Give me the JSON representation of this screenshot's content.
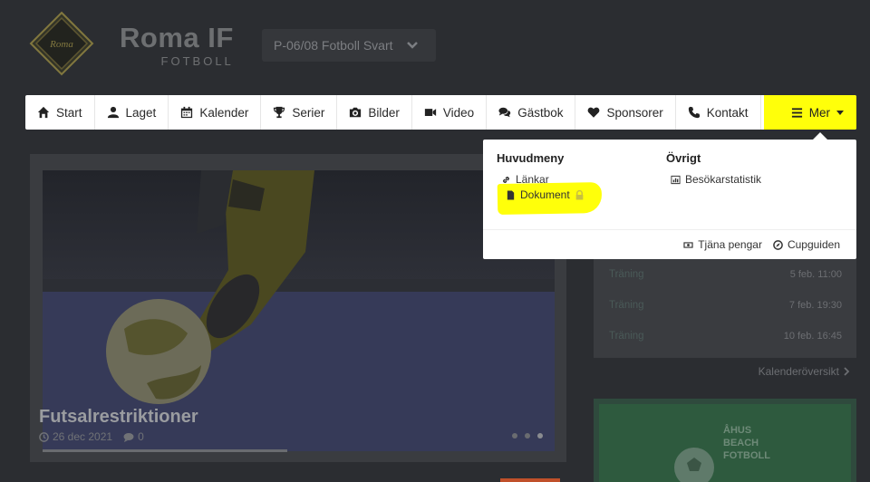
{
  "header": {
    "brand_name": "Roma IF",
    "brand_sub": "FOTBOLL",
    "logo_text": "Roma",
    "team_select": "P-06/08 Fotboll Svart"
  },
  "nav": {
    "items": [
      {
        "label": "Start",
        "icon": "home-icon"
      },
      {
        "label": "Laget",
        "icon": "user-icon"
      },
      {
        "label": "Kalender",
        "icon": "calendar-icon"
      },
      {
        "label": "Serier",
        "icon": "trophy-icon"
      },
      {
        "label": "Bilder",
        "icon": "camera-icon"
      },
      {
        "label": "Video",
        "icon": "video-icon"
      },
      {
        "label": "Gästbok",
        "icon": "comments-icon"
      },
      {
        "label": "Sponsorer",
        "icon": "heart-icon"
      },
      {
        "label": "Kontakt",
        "icon": "phone-icon"
      }
    ],
    "more_label": "Mer",
    "highlight_color": "#ffff0a"
  },
  "dropdown": {
    "main_heading": "Huvudmeny",
    "main_links": [
      "Länkar",
      "Dokument"
    ],
    "other_heading": "Övrigt",
    "other_links": [
      "Besökarstatistik"
    ],
    "footer_links": [
      "Tjäna pengar",
      "Cupguiden"
    ]
  },
  "hero": {
    "title": "Futsalrestriktioner",
    "date": "26 dec 2021",
    "comments": "0"
  },
  "events": [
    {
      "label": "Träning",
      "date": "5 feb. 11:00"
    },
    {
      "label": "Träning",
      "date": "7 feb. 19:30"
    },
    {
      "label": "Träning",
      "date": "10 feb. 16:45"
    }
  ],
  "calendar_link": "Kalenderöversikt",
  "sponsor": {
    "line1": "ÅHUS",
    "line2": "BEACH",
    "line3": "FOTBOLL"
  }
}
